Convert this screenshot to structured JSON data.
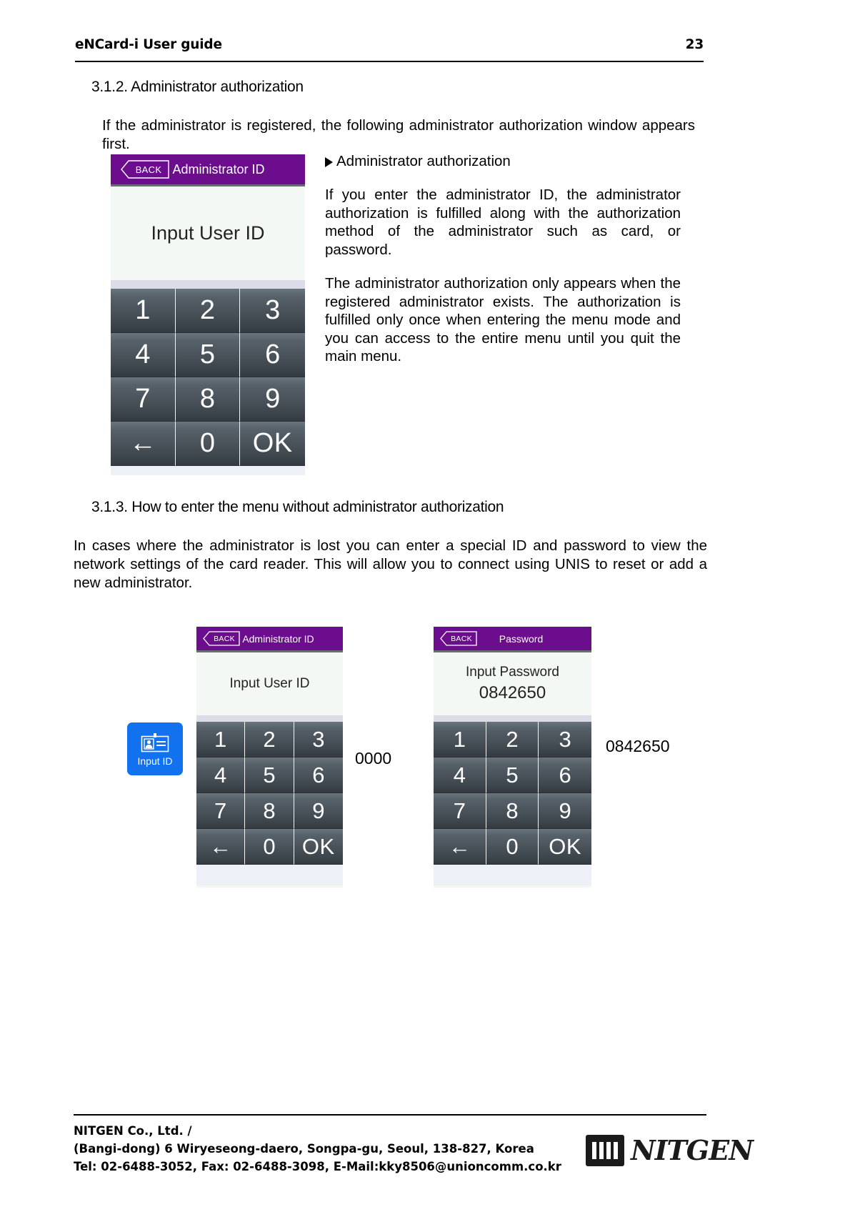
{
  "header": {
    "doc_title": "eNCard-i User guide",
    "page_number": "23"
  },
  "sections": {
    "s312": {
      "heading": "3.1.2. Administrator authorization",
      "intro": "If the administrator is registered, the following administrator authorization window appears first."
    },
    "s313": {
      "heading": "3.1.3. How to enter the menu without administrator authorization",
      "body": "In cases where the administrator is lost you can enter a special ID and password to view the network settings of the card reader. This will allow you to connect using UNIS to reset or add a new administrator."
    }
  },
  "side_column": {
    "title": "Administrator authorization",
    "paragraph_1": "If you enter the administrator ID, the administrator authorization is fulfilled along with the authorization method of the administrator such as card, or password.",
    "paragraph_2": "The administrator authorization only appears when the registered administrator exists.  The authorization is fulfilled only once when entering the menu mode and you can access to the entire menu until you quit the main menu."
  },
  "devices": {
    "admin_large": {
      "back_label": "BACK",
      "title": "Administrator ID",
      "prompt": "Input User ID"
    },
    "admin_small": {
      "back_label": "BACK",
      "title": "Administrator ID",
      "prompt": "Input User ID"
    },
    "password": {
      "back_label": "BACK",
      "title": "Password",
      "prompt": "Input Password",
      "value": "0842650"
    }
  },
  "keypad": {
    "keys": [
      "1",
      "2",
      "3",
      "4",
      "5",
      "6",
      "7",
      "8",
      "9",
      "←",
      "0",
      "OK"
    ]
  },
  "input_id_tile": {
    "label": "Input ID",
    "icon": "id-badge-icon",
    "color": "#1271ef"
  },
  "callouts": {
    "user_id": "0000",
    "password": "0842650"
  },
  "footer": {
    "line1": "NITGEN Co., Ltd. /",
    "line2": "(Bangi-dong) 6 Wiryeseong-daero, Songpa-gu, Seoul, 138-827, Korea",
    "line3": "Tel: 02-6488-3052, Fax: 02-6488-3098, E-Mail:kky8506@unioncomm.co.kr",
    "logo_text": "NITGEN"
  },
  "theme": {
    "header_purple": "#6b0d8c",
    "key_dark": "#3f474e",
    "screen_bg": "#f4f8f4"
  }
}
